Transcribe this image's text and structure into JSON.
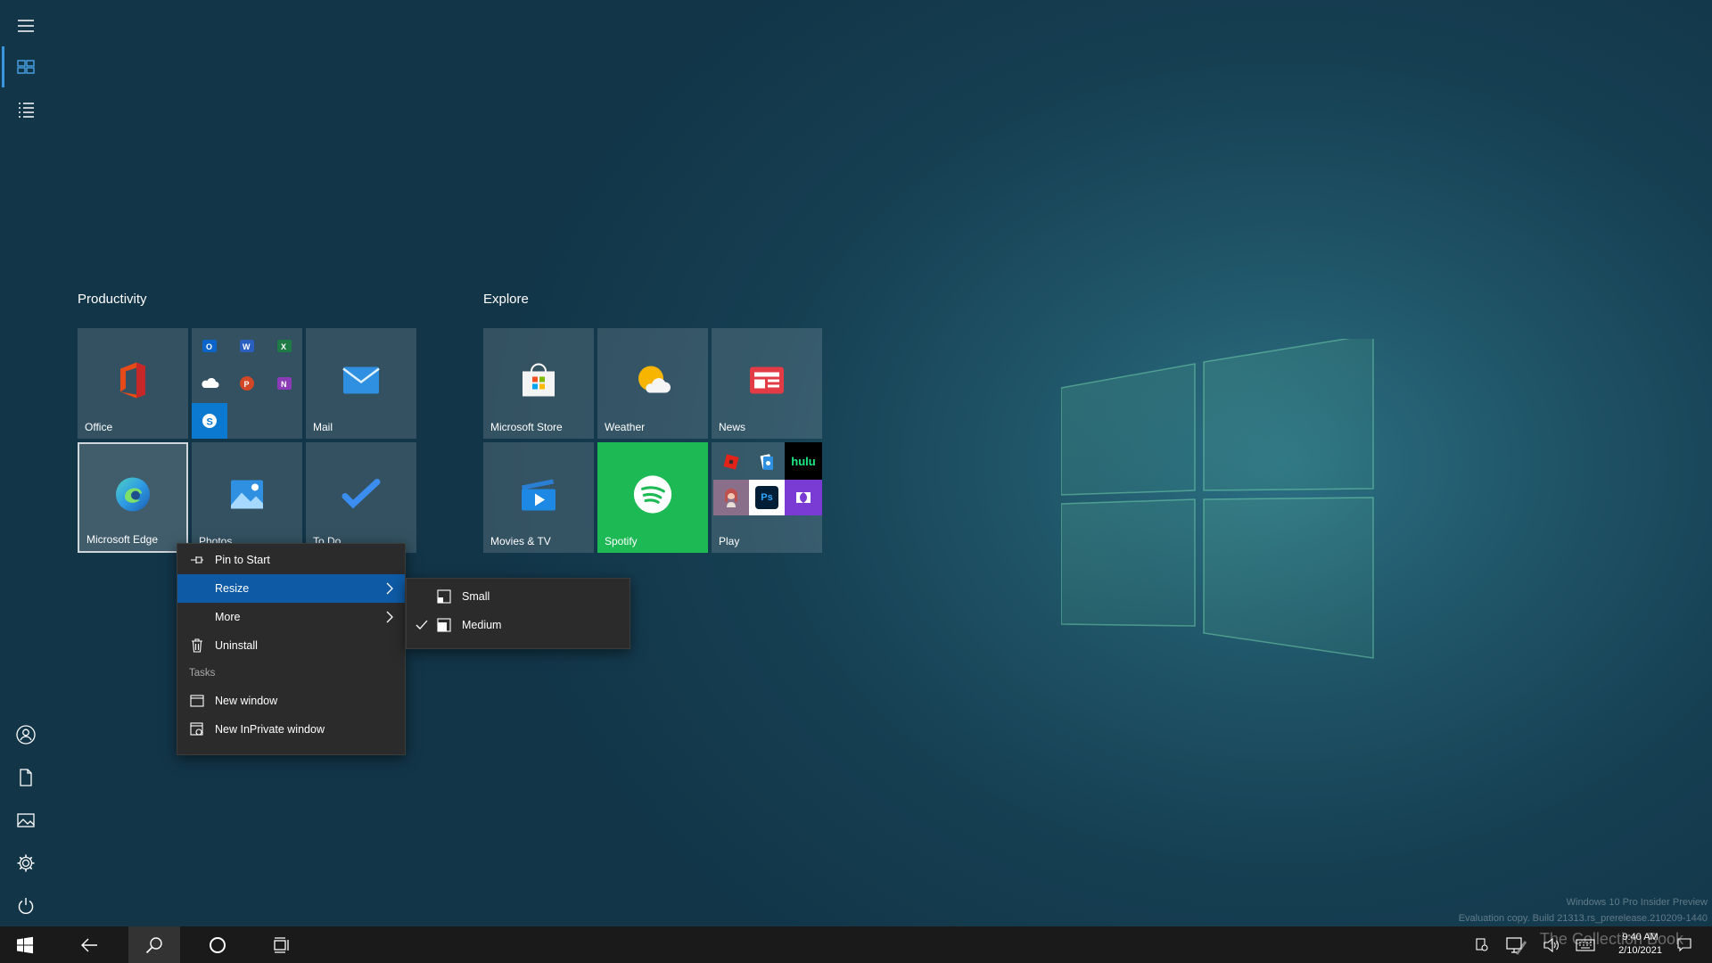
{
  "colors": {
    "accent": "#0e5aa5",
    "tile_bg": "#3e5d69",
    "spotify_green": "#1db954",
    "menu_bg": "#2b2b2b",
    "taskbar_bg": "#1a1a1a"
  },
  "rail": {
    "items": [
      {
        "icon": "hamburger-menu-icon"
      },
      {
        "icon": "pinned-tiles-icon",
        "active": true
      },
      {
        "icon": "all-apps-list-icon"
      },
      {
        "icon": "user-account-icon"
      },
      {
        "icon": "documents-icon"
      },
      {
        "icon": "pictures-icon"
      },
      {
        "icon": "settings-gear-icon"
      },
      {
        "icon": "power-icon"
      }
    ]
  },
  "groups": [
    {
      "title": "Productivity",
      "tiles": [
        {
          "label": "Office",
          "icon": "office-icon"
        },
        {
          "label": "",
          "icon": "office-apps-folder-icon",
          "mini_icons": [
            "outlook-icon",
            "word-icon",
            "excel-icon",
            "onedrive-icon",
            "powerpoint-icon",
            "onenote-icon",
            "skype-icon"
          ]
        },
        {
          "label": "Mail",
          "icon": "mail-icon"
        },
        {
          "label": "Microsoft Edge",
          "icon": "edge-icon",
          "selected": true
        },
        {
          "label": "Photos",
          "icon": "photos-icon"
        },
        {
          "label": "To Do",
          "icon": "todo-icon"
        }
      ]
    },
    {
      "title": "Explore",
      "tiles": [
        {
          "label": "Microsoft Store",
          "icon": "store-icon"
        },
        {
          "label": "Weather",
          "icon": "weather-icon"
        },
        {
          "label": "News",
          "icon": "news-icon"
        },
        {
          "label": "Movies & TV",
          "icon": "movies-tv-icon"
        },
        {
          "label": "Spotify",
          "icon": "spotify-icon"
        },
        {
          "label": "Play",
          "icon": "play-folder-icon",
          "mini_icons": [
            "roblox-icon",
            "solitaire-icon",
            "hulu-icon",
            "game-character-icon",
            "photoshop-icon",
            "dolby-icon"
          ],
          "mini_texts": {
            "hulu": "hulu",
            "ps": "Ps"
          }
        }
      ]
    }
  ],
  "context_menu": {
    "items": [
      {
        "label": "Pin to Start",
        "icon": "pin-icon"
      },
      {
        "label": "Resize",
        "icon": "",
        "submenu": true,
        "highlighted": true
      },
      {
        "label": "More",
        "icon": "",
        "submenu": true
      },
      {
        "label": "Uninstall",
        "icon": "trash-icon"
      }
    ],
    "tasks_header": "Tasks",
    "tasks": [
      {
        "label": "New window",
        "icon": "window-icon"
      },
      {
        "label": "New InPrivate window",
        "icon": "inprivate-window-icon"
      }
    ]
  },
  "resize_submenu": {
    "items": [
      {
        "label": "Small",
        "checked": false,
        "icon": "small-tile-icon"
      },
      {
        "label": "Medium",
        "checked": true,
        "icon": "medium-tile-icon"
      }
    ]
  },
  "taskbar": {
    "buttons": [
      "start-icon",
      "back-icon",
      "search-icon",
      "cortana-icon",
      "task-view-icon"
    ],
    "tray_icons": [
      "people-icon",
      "network-icon",
      "volume-icon",
      "keyboard-icon"
    ],
    "time": "9:40 AM",
    "date": "2/10/2021",
    "notification_icon": "action-center-icon"
  },
  "watermark": {
    "line1": "Windows 10 Pro Insider Preview",
    "line2": "Evaluation copy. Build 21313.rs_prerelease.210209-1440",
    "overlay": "The Collection Book"
  }
}
